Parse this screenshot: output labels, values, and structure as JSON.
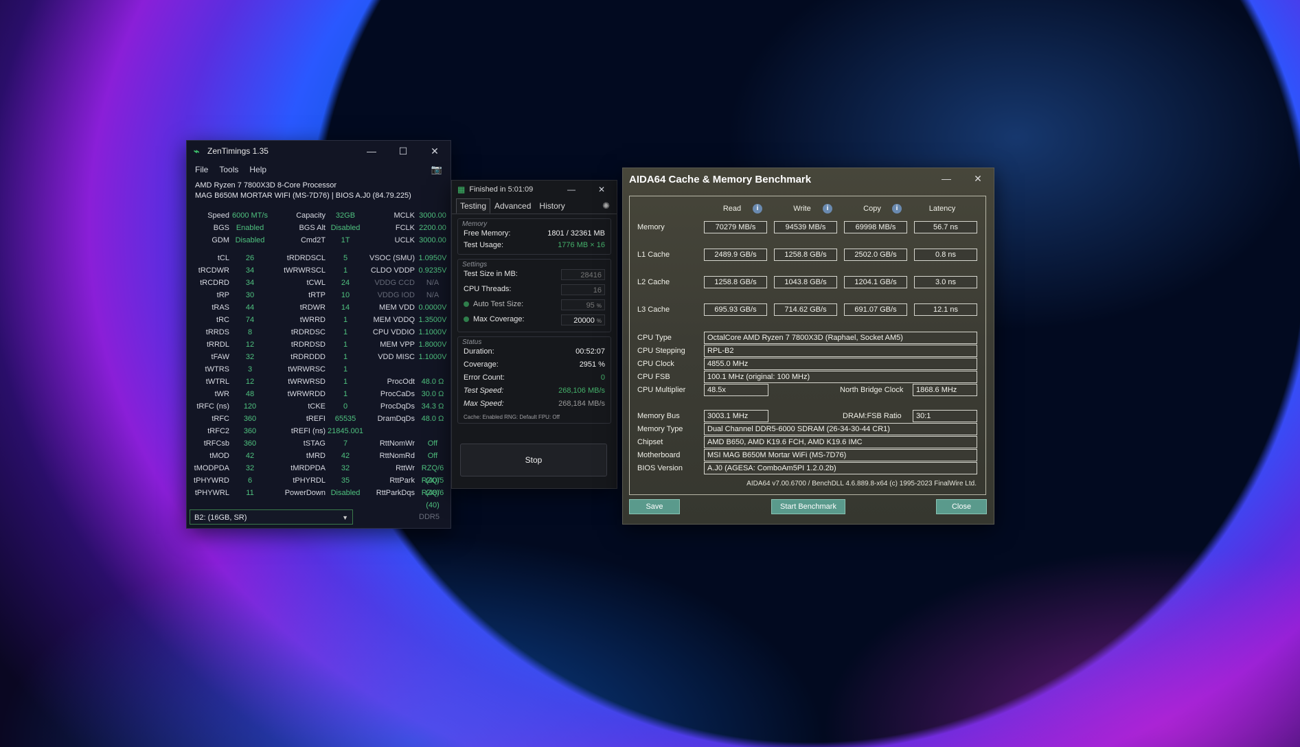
{
  "zentimings": {
    "title": "ZenTimings 1.35",
    "menu": [
      "File",
      "Tools",
      "Help"
    ],
    "cpu": "AMD Ryzen 7 7800X3D 8-Core Processor",
    "board": "MAG B650M MORTAR WIFI (MS-7D76) | BIOS A.J0 (84.79.225)",
    "top_rows": [
      [
        "Speed",
        "6000 MT/s",
        "Capacity",
        "32GB",
        "MCLK",
        "3000.00"
      ],
      [
        "BGS",
        "Enabled",
        "BGS Alt",
        "Disabled",
        "FCLK",
        "2200.00"
      ],
      [
        "GDM",
        "Disabled",
        "Cmd2T",
        "1T",
        "UCLK",
        "3000.00"
      ]
    ],
    "rows": [
      [
        "tCL",
        "26",
        "tRDRDSCL",
        "5",
        "VSOC (SMU)",
        "1.0950V"
      ],
      [
        "tRCDWR",
        "34",
        "tWRWRSCL",
        "1",
        "CLDO VDDP",
        "0.9235V"
      ],
      [
        "tRCDRD",
        "34",
        "tCWL",
        "24",
        "VDDG CCD",
        "N/A"
      ],
      [
        "tRP",
        "30",
        "tRTP",
        "10",
        "VDDG IOD",
        "N/A"
      ],
      [
        "tRAS",
        "44",
        "tRDWR",
        "14",
        "MEM VDD",
        "0.0000V"
      ],
      [
        "tRC",
        "74",
        "tWRRD",
        "1",
        "MEM VDDQ",
        "1.3500V"
      ],
      [
        "tRRDS",
        "8",
        "tRDRDSC",
        "1",
        "CPU VDDIO",
        "1.1000V"
      ],
      [
        "tRRDL",
        "12",
        "tRDRDSD",
        "1",
        "MEM VPP",
        "1.8000V"
      ],
      [
        "tFAW",
        "32",
        "tRDRDDD",
        "1",
        "VDD MISC",
        "1.1000V"
      ],
      [
        "tWTRS",
        "3",
        "tWRWRSC",
        "1",
        "",
        ""
      ],
      [
        "tWTRL",
        "12",
        "tWRWRSD",
        "1",
        "ProcOdt",
        "48.0 Ω"
      ],
      [
        "tWR",
        "48",
        "tWRWRDD",
        "1",
        "ProcCaDs",
        "30.0 Ω"
      ],
      [
        "tRFC (ns)",
        "120",
        "tCKE",
        "0",
        "ProcDqDs",
        "34.3 Ω"
      ],
      [
        "tRFC",
        "360",
        "tREFI",
        "65535",
        "DramDqDs",
        "48.0 Ω"
      ],
      [
        "tRFC2",
        "360",
        "tREFI (ns)",
        "21845.001",
        "",
        ""
      ],
      [
        "tRFCsb",
        "360",
        "tSTAG",
        "7",
        "RttNomWr",
        "Off"
      ],
      [
        "tMOD",
        "42",
        "tMRD",
        "42",
        "RttNomRd",
        "Off"
      ],
      [
        "tMODPDA",
        "32",
        "tMRDPDA",
        "32",
        "RttWr",
        "RZQ/6 (40)"
      ],
      [
        "tPHYWRD",
        "6",
        "tPHYRDL",
        "35",
        "RttPark",
        "RZQ/5 (48)"
      ],
      [
        "tPHYWRL",
        "11",
        "PowerDown",
        "Disabled",
        "RttParkDqs",
        "RZQ/6 (40)"
      ]
    ],
    "dimm_select": "B2: (16GB, SR)",
    "ddr": "DDR5"
  },
  "testmem": {
    "title": "Finished in 5:01:09",
    "tabs": [
      "Testing",
      "Advanced",
      "History"
    ],
    "memory_label": "Memory",
    "free_memory_label": "Free Memory:",
    "free_memory": "1801 / 32361 MB",
    "test_usage_label": "Test Usage:",
    "test_usage": "1776 MB × 16",
    "settings_label": "Settings",
    "test_size_label": "Test Size in MB:",
    "test_size": "28416",
    "cpu_threads_label": "CPU Threads:",
    "cpu_threads": "16",
    "auto_test_label": "Auto Test Size:",
    "auto_test": "95",
    "max_cov_label": "Max Coverage:",
    "max_cov": "20000",
    "pct": "%",
    "status_label": "Status",
    "duration_label": "Duration:",
    "duration": "00:52:07",
    "coverage_label": "Coverage:",
    "coverage": "2951 %",
    "errors_label": "Error Count:",
    "errors": "0",
    "test_speed_label": "Test Speed:",
    "test_speed": "268,106 MB/s",
    "max_speed_label": "Max Speed:",
    "max_speed": "268,184 MB/s",
    "footer": "Cache: Enabled  RNG: Default  FPU: Off",
    "stop": "Stop"
  },
  "aida": {
    "title": "AIDA64 Cache & Memory Benchmark",
    "headers": [
      "Read",
      "Write",
      "Copy",
      "Latency"
    ],
    "rows": [
      {
        "label": "Memory",
        "values": [
          "70279 MB/s",
          "94539 MB/s",
          "69998 MB/s",
          "56.7 ns"
        ]
      },
      {
        "label": "L1 Cache",
        "values": [
          "2489.9 GB/s",
          "1258.8 GB/s",
          "2502.0 GB/s",
          "0.8 ns"
        ]
      },
      {
        "label": "L2 Cache",
        "values": [
          "1258.8 GB/s",
          "1043.8 GB/s",
          "1204.1 GB/s",
          "3.0 ns"
        ]
      },
      {
        "label": "L3 Cache",
        "values": [
          "695.93 GB/s",
          "714.62 GB/s",
          "691.07 GB/s",
          "12.1 ns"
        ]
      }
    ],
    "cpu_type_label": "CPU Type",
    "cpu_type": "OctalCore AMD Ryzen 7 7800X3D  (Raphael, Socket AM5)",
    "cpu_stepping_label": "CPU Stepping",
    "cpu_stepping": "RPL-B2",
    "cpu_clock_label": "CPU Clock",
    "cpu_clock": "4855.0 MHz",
    "cpu_fsb_label": "CPU FSB",
    "cpu_fsb": "100.1 MHz  (original: 100 MHz)",
    "cpu_mult_label": "CPU Multiplier",
    "cpu_mult": "48.5x",
    "nb_clock_label": "North Bridge Clock",
    "nb_clock": "1868.6 MHz",
    "mem_bus_label": "Memory Bus",
    "mem_bus": "3003.1 MHz",
    "dram_ratio_label": "DRAM:FSB Ratio",
    "dram_ratio": "30:1",
    "mem_type_label": "Memory Type",
    "mem_type": "Dual Channel DDR5-6000 SDRAM  (26-34-30-44 CR1)",
    "chipset_label": "Chipset",
    "chipset": "AMD B650, AMD K19.6 FCH, AMD K19.6 IMC",
    "mobo_label": "Motherboard",
    "mobo": "MSI MAG B650M Mortar WiFi (MS-7D76)",
    "bios_label": "BIOS Version",
    "bios": "A.J0  (AGESA: ComboAm5PI 1.2.0.2b)",
    "footer": "AIDA64 v7.00.6700 / BenchDLL 4.6.889.8-x64  (c) 1995-2023 FinalWire Ltd.",
    "save": "Save",
    "start": "Start Benchmark",
    "close": "Close"
  }
}
